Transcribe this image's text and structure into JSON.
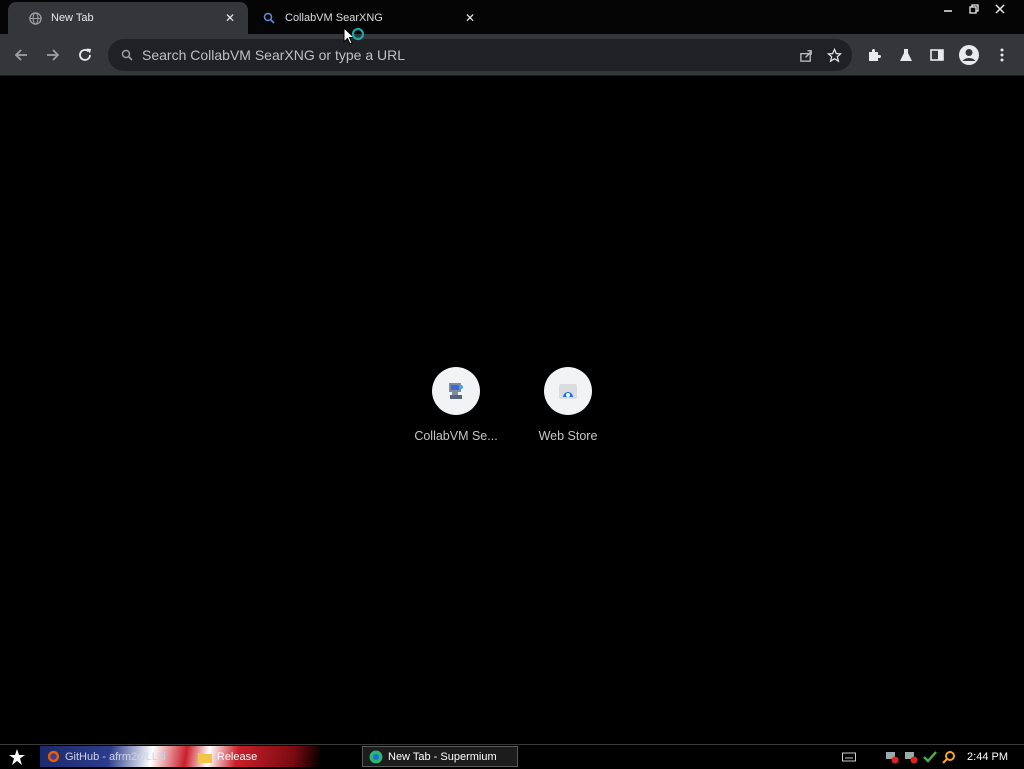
{
  "tabs": [
    {
      "title": "New Tab",
      "favicon": "globe-icon",
      "active": true
    },
    {
      "title": "CollabVM SearXNG",
      "favicon": "searxng-icon",
      "active": false
    }
  ],
  "omnibox": {
    "placeholder": "Search CollabVM SearXNG or type a URL",
    "value": ""
  },
  "shortcuts": [
    {
      "label": "CollabVM Se...",
      "icon": "collabvm-icon"
    },
    {
      "label": "Web Store",
      "icon": "web-store-icon"
    }
  ],
  "taskbar": {
    "items": [
      {
        "label": "GitHub - afrm2c/LLxi",
        "icon": "firefox-icon"
      },
      {
        "label": "Release",
        "icon": "folder-icon"
      },
      {
        "label": "New Tab - Supermium",
        "icon": "supermium-icon"
      }
    ],
    "clock": "2:44 PM"
  },
  "colors": {
    "toolbar": "#35363a",
    "omnibox": "#202124",
    "page": "#000000"
  }
}
